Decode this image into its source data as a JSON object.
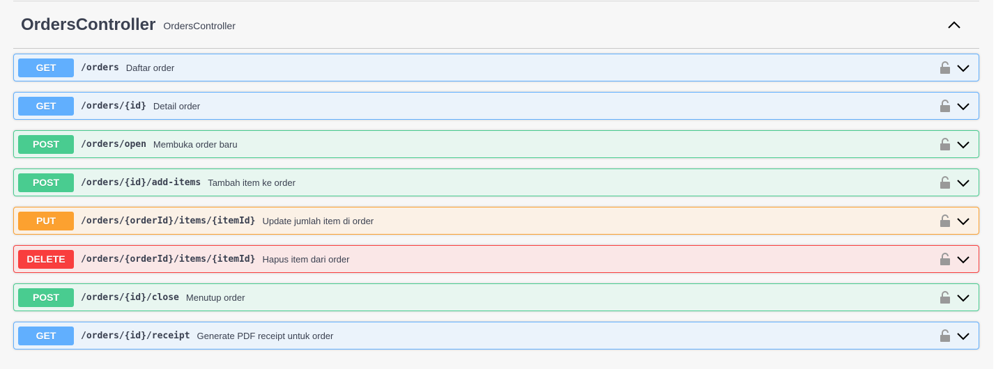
{
  "tag": {
    "title": "OrdersController",
    "description": "OrdersController"
  },
  "operations": [
    {
      "method": "GET",
      "path": "/orders",
      "summary": "Daftar order"
    },
    {
      "method": "GET",
      "path": "/orders/{id}",
      "summary": "Detail order"
    },
    {
      "method": "POST",
      "path": "/orders/open",
      "summary": "Membuka order baru"
    },
    {
      "method": "POST",
      "path": "/orders/{id}/add-items",
      "summary": "Tambah item ke order"
    },
    {
      "method": "PUT",
      "path": "/orders/{orderId}/items/{itemId}",
      "summary": "Update jumlah item di order"
    },
    {
      "method": "DELETE",
      "path": "/orders/{orderId}/items/{itemId}",
      "summary": "Hapus item dari order"
    },
    {
      "method": "POST",
      "path": "/orders/{id}/close",
      "summary": "Menutup order"
    },
    {
      "method": "GET",
      "path": "/orders/{id}/receipt",
      "summary": "Generate PDF receipt untuk order"
    }
  ],
  "colors": {
    "get": "#61affe",
    "post": "#49cc90",
    "put": "#fca130",
    "delete": "#f93e3e",
    "text": "#3b4151"
  },
  "icons": {
    "tag_toggle": "chevron-up-icon",
    "auth": "lock-icon",
    "expand": "chevron-down-icon"
  }
}
